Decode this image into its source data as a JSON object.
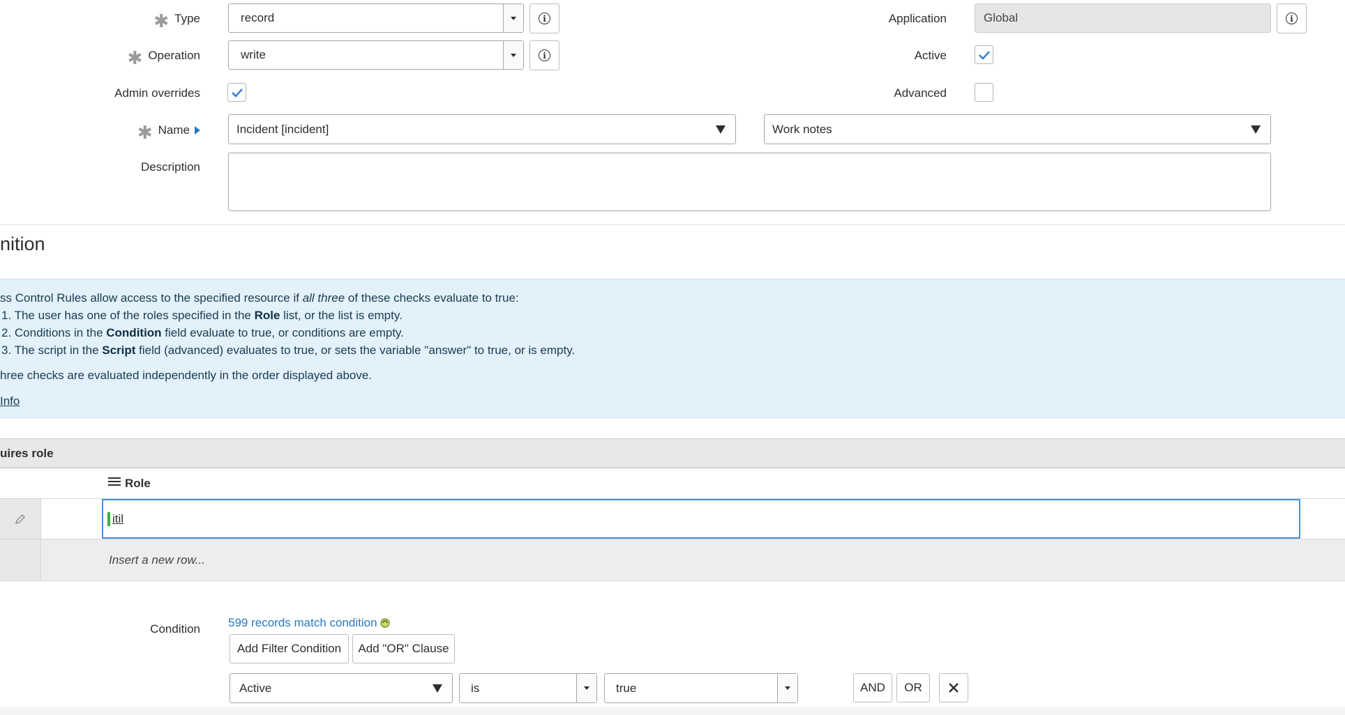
{
  "form": {
    "type_label": "Type",
    "type_value": "record",
    "operation_label": "Operation",
    "operation_value": "write",
    "admin_overrides_label": "Admin overrides",
    "name_label": "Name",
    "name_table_value": "Incident [incident]",
    "name_field_value": "Work notes",
    "description_label": "Description",
    "application_label": "Application",
    "application_value": "Global",
    "active_label": "Active",
    "advanced_label": "Advanced"
  },
  "definition": {
    "title": "nition",
    "intro_pre": "ss Control Rules allow access to the specified resource if ",
    "intro_em": "all three",
    "intro_post": " of these checks evaluate to true:",
    "item1_pre": "1. The user has one of the roles specified in the ",
    "item1_bold": "Role",
    "item1_post": " list, or the list is empty.",
    "item2_pre": "2. Conditions in the ",
    "item2_bold": "Condition",
    "item2_post": " field evaluate to true, or conditions are empty.",
    "item3_pre": "3. The script in the ",
    "item3_bold": "Script",
    "item3_post": " field (advanced) evaluates to true, or sets the variable \"answer\" to true, or is empty.",
    "order_note": "hree checks are evaluated independently in the order displayed above.",
    "more_info": "Info"
  },
  "roles": {
    "section_label": "uires role",
    "column_header": "Role",
    "row_value": "itil",
    "insert_placeholder": "Insert a new row..."
  },
  "condition": {
    "label": "Condition",
    "match_text": "599 records match condition",
    "add_filter_button": "Add Filter Condition",
    "add_or_button": "Add \"OR\" Clause",
    "field_value": "Active",
    "operator_value": "is",
    "value_value": "true",
    "and_button": "AND",
    "or_button": "OR"
  },
  "colors": {
    "accent_blue": "#2877c4",
    "check_blue": "#2b7bd6",
    "info_bg": "#e2f1fa",
    "green_cursor": "#3cb043"
  }
}
